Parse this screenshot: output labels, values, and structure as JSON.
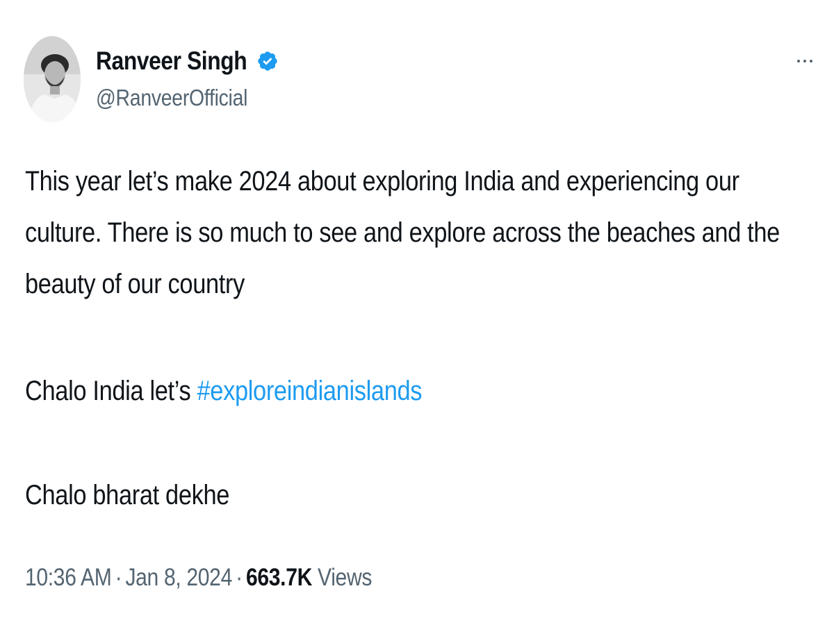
{
  "author": {
    "display_name": "Ranveer Singh",
    "handle": "@RanveerOfficial",
    "verified": true,
    "avatar_icon": "profile-photo"
  },
  "menu": {
    "more_icon": "ellipsis-icon"
  },
  "tweet": {
    "lines": [
      "This year let’s make 2024 about exploring India and experiencing our",
      "culture. There is so much to see and explore across the beaches and the",
      "beauty of our country"
    ],
    "line4_prefix": "Chalo India let’s ",
    "hashtag": "#exploreindianislands",
    "line5": "Chalo bharat dekhe"
  },
  "meta": {
    "time": "10:36 AM",
    "date": "Jan 8, 2024",
    "separator": "·",
    "views_count": "663.7K",
    "views_label": "Views"
  },
  "colors": {
    "link": "#1d9bf0",
    "secondary_text": "#536471",
    "primary_text": "#0f1419",
    "verified_badge": "#1d9bf0"
  }
}
